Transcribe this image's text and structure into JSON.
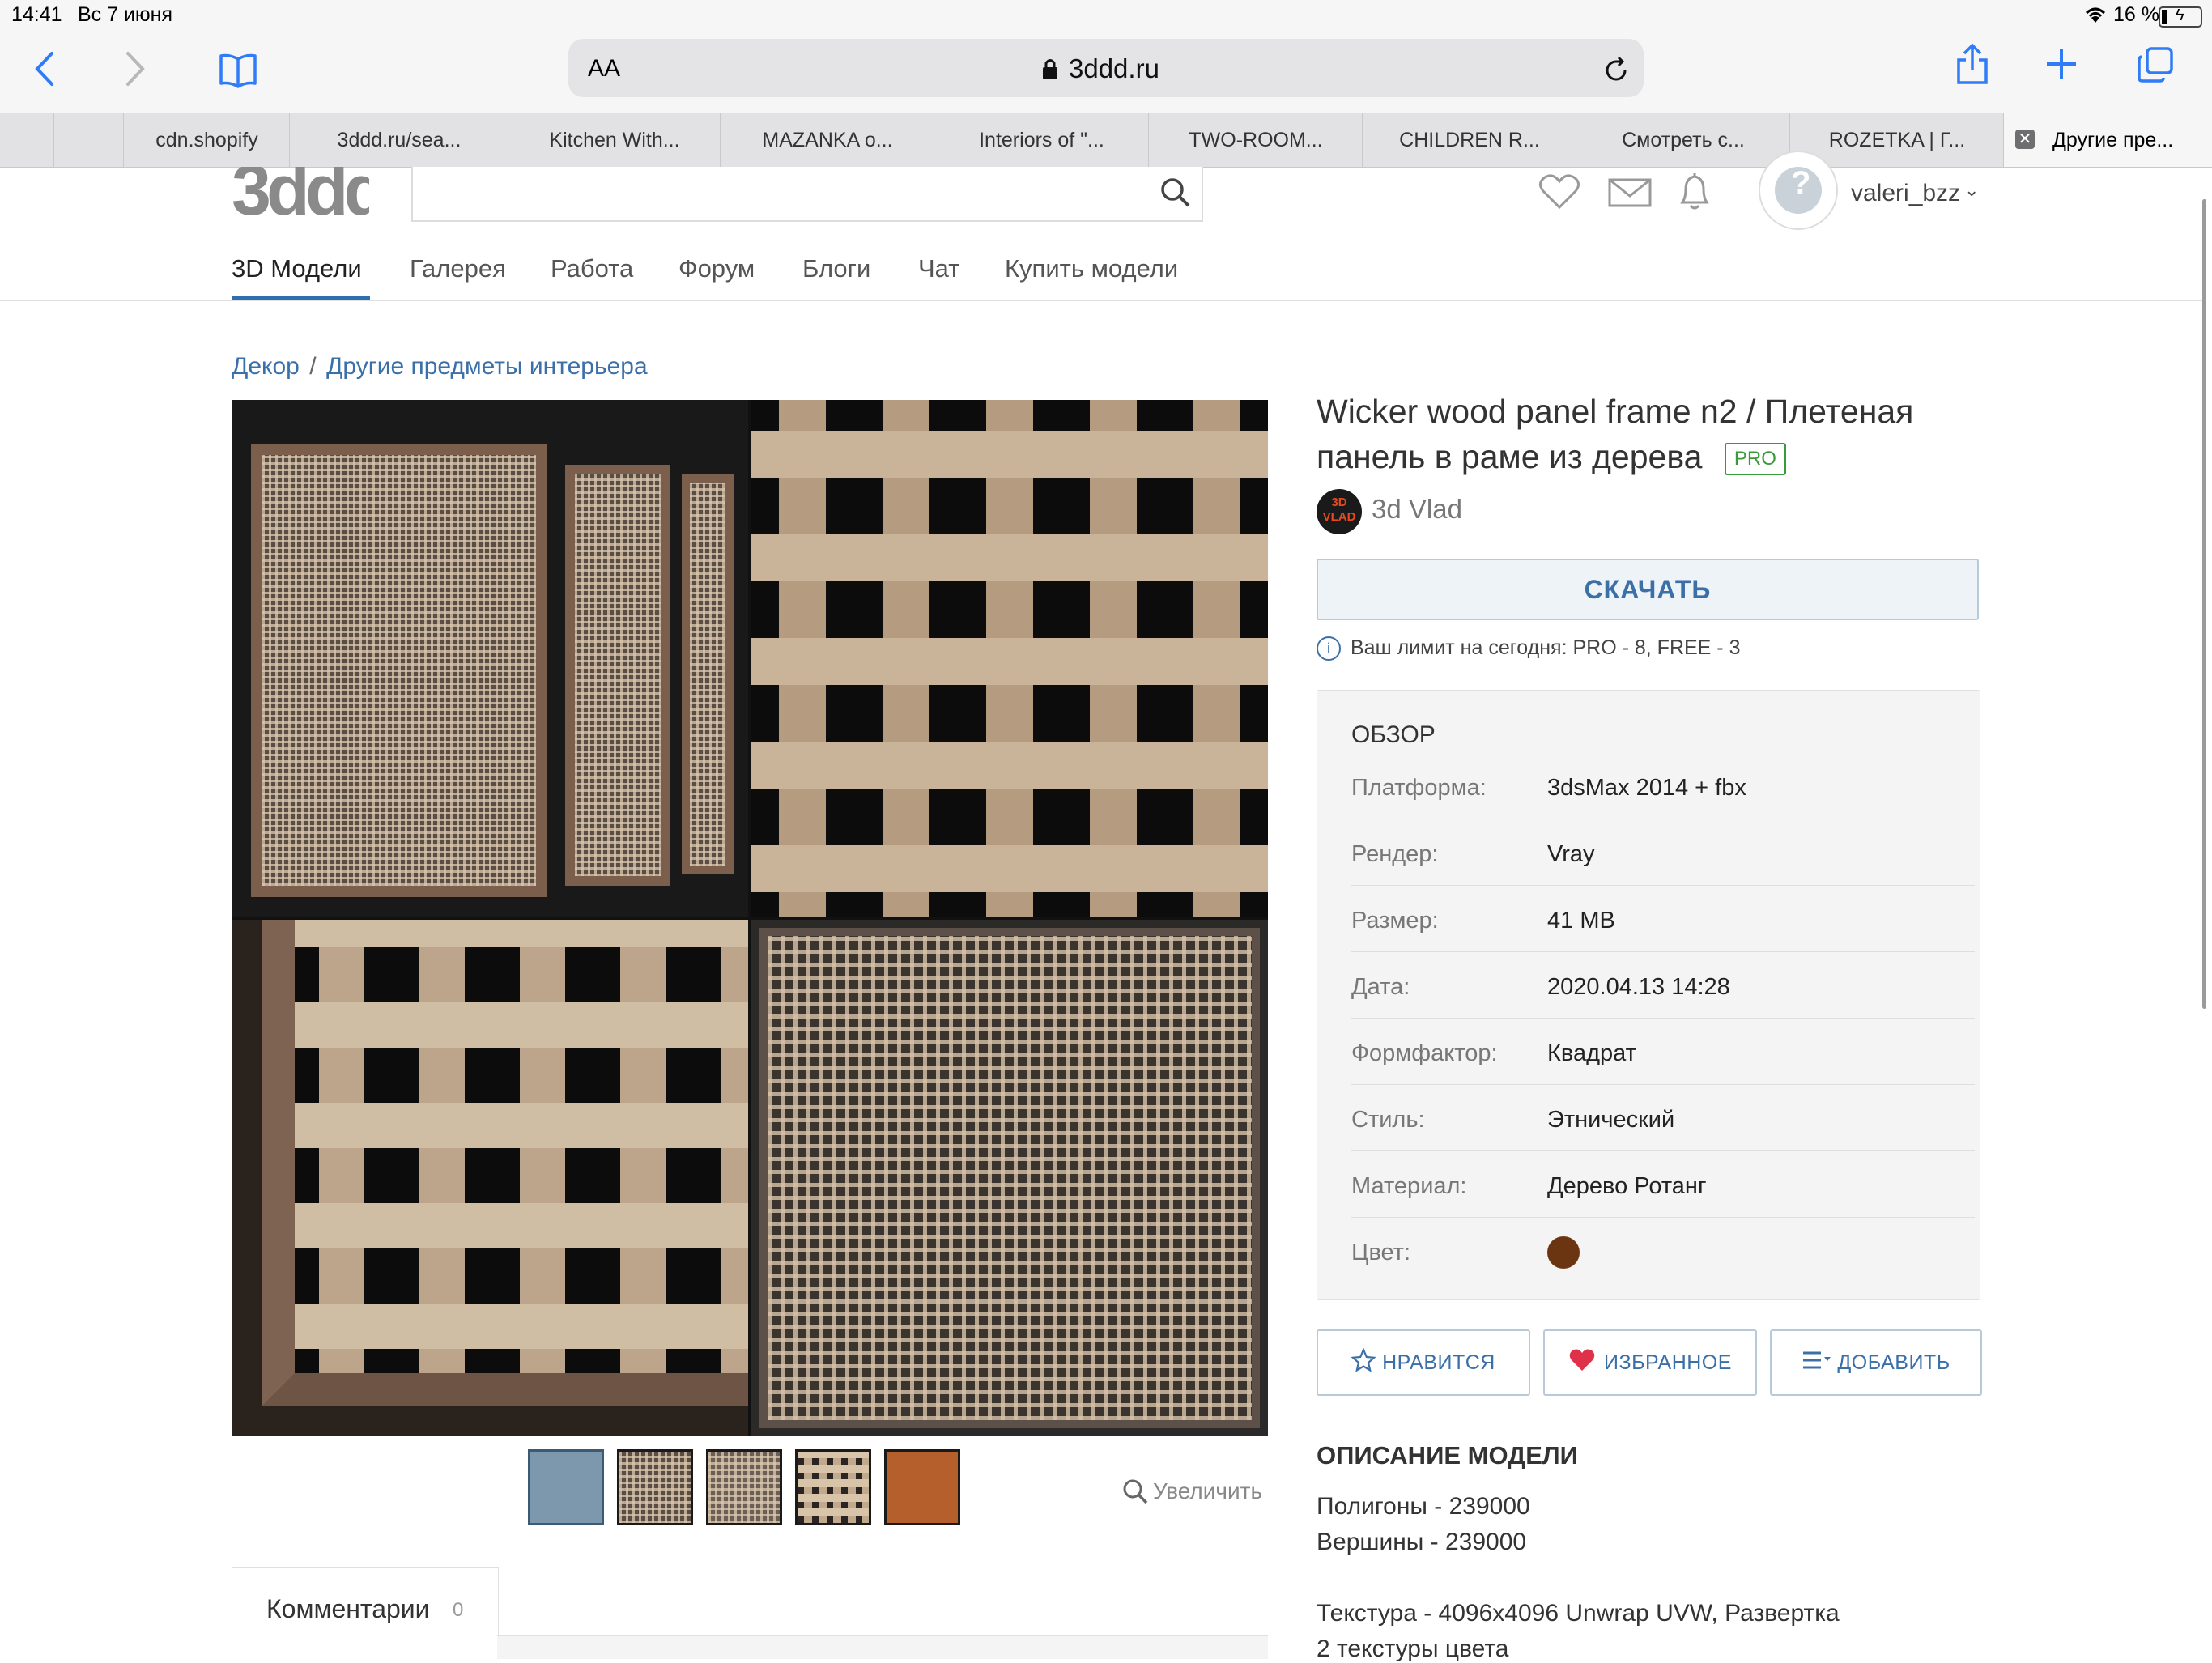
{
  "status_bar": {
    "time": "14:41",
    "date": "Вс 7 июня",
    "battery": "16 %"
  },
  "browser": {
    "reader_label": "AA",
    "url": "3ddd.ru",
    "tabs": [
      {
        "label": "cdn.shopify"
      },
      {
        "label": "3ddd.ru/sea..."
      },
      {
        "label": "Kitchen With..."
      },
      {
        "label": "MAZANKA o..."
      },
      {
        "label": "Interiors of \"..."
      },
      {
        "label": "TWO-ROOM..."
      },
      {
        "label": "CHILDREN R..."
      },
      {
        "label": "Смотреть с..."
      },
      {
        "label": "ROZETKA | Г..."
      },
      {
        "label": "Другие пре..."
      }
    ]
  },
  "site": {
    "logo": "3ddd",
    "search": {
      "placeholder": "",
      "value": ""
    },
    "username": "valeri_bzz",
    "nav": [
      {
        "label": "3D Модели"
      },
      {
        "label": "Галерея"
      },
      {
        "label": "Работа"
      },
      {
        "label": "Форум"
      },
      {
        "label": "Блоги"
      },
      {
        "label": "Чат"
      },
      {
        "label": "Купить модели"
      }
    ]
  },
  "breadcrumb": {
    "level1": "Декор",
    "separator": "/",
    "level2": "Другие предметы интерьера"
  },
  "model": {
    "title_line1": "Wicker wood panel frame n2 / Плетеная",
    "title_line2": "панель в раме из дерева",
    "badge": "PRO",
    "author": "3d Vlad",
    "author_avatar_text": "3D VLAD",
    "download_label": "СКАЧАТЬ",
    "limit_text": "Ваш лимит на сегодня: PRO - 8, FREE - 3",
    "zoom_label": "Увеличить"
  },
  "overview": {
    "title": "ОБЗОР",
    "rows": [
      {
        "label": "Платформа:",
        "value": "3dsMax 2014 + fbx"
      },
      {
        "label": "Рендер:",
        "value": "Vray"
      },
      {
        "label": "Размер:",
        "value": "41 MB"
      },
      {
        "label": "Дата:",
        "value": "2020.04.13 14:28"
      },
      {
        "label": "Формфактор:",
        "value": "Квадрат"
      },
      {
        "label": "Стиль:",
        "value": "Этнический"
      },
      {
        "label": "Материал:",
        "value": "Дерево Ротанг"
      },
      {
        "label": "Цвет:",
        "value": ""
      }
    ],
    "color_swatch": "#6b3512"
  },
  "actions": {
    "like": "НРАВИТСЯ",
    "favorite": "ИЗБРАННОЕ",
    "add": "ДОБАВИТЬ"
  },
  "description": {
    "title": "ОПИСАНИЕ МОДЕЛИ",
    "line1": "Полигоны - 239000",
    "line2": "Вершины - 239000",
    "line3": "Текстура - 4096x4096 Unwrap UVW, Развертка",
    "line4": "2 текстуры цвета"
  },
  "comments": {
    "label": "Комментарии",
    "count": "0"
  },
  "colors": {
    "accent": "#3b6fa8",
    "ios_blue": "#2f7cf6",
    "pro_green": "#3a9a3a",
    "heart_red": "#e0314b"
  }
}
